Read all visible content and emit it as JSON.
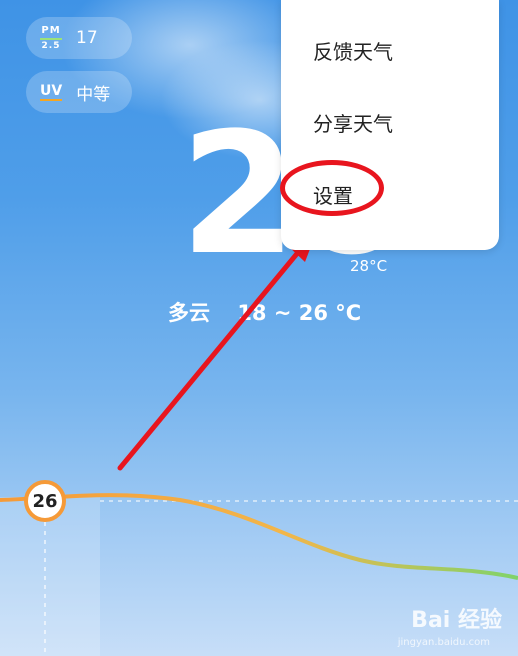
{
  "air": {
    "pm_label_top": "PM",
    "pm_label_bottom": "2.5",
    "pm_value": "17",
    "uv_label": "UV",
    "uv_value": "中等"
  },
  "current": {
    "temperature": "26",
    "feels_like": "28°C",
    "condition": "多云",
    "range": "18 ~ 26 °C"
  },
  "menu": {
    "items": [
      "反馈天气",
      "分享天气",
      "设置"
    ]
  },
  "chart": {
    "current_value": "26"
  },
  "watermark": {
    "text": "Bai 经验",
    "sub": "jingyan.baidu.com"
  },
  "colors": {
    "highlight": "#e8151e",
    "curve_start": "#f59a38",
    "curve_end": "#7fd36a"
  }
}
